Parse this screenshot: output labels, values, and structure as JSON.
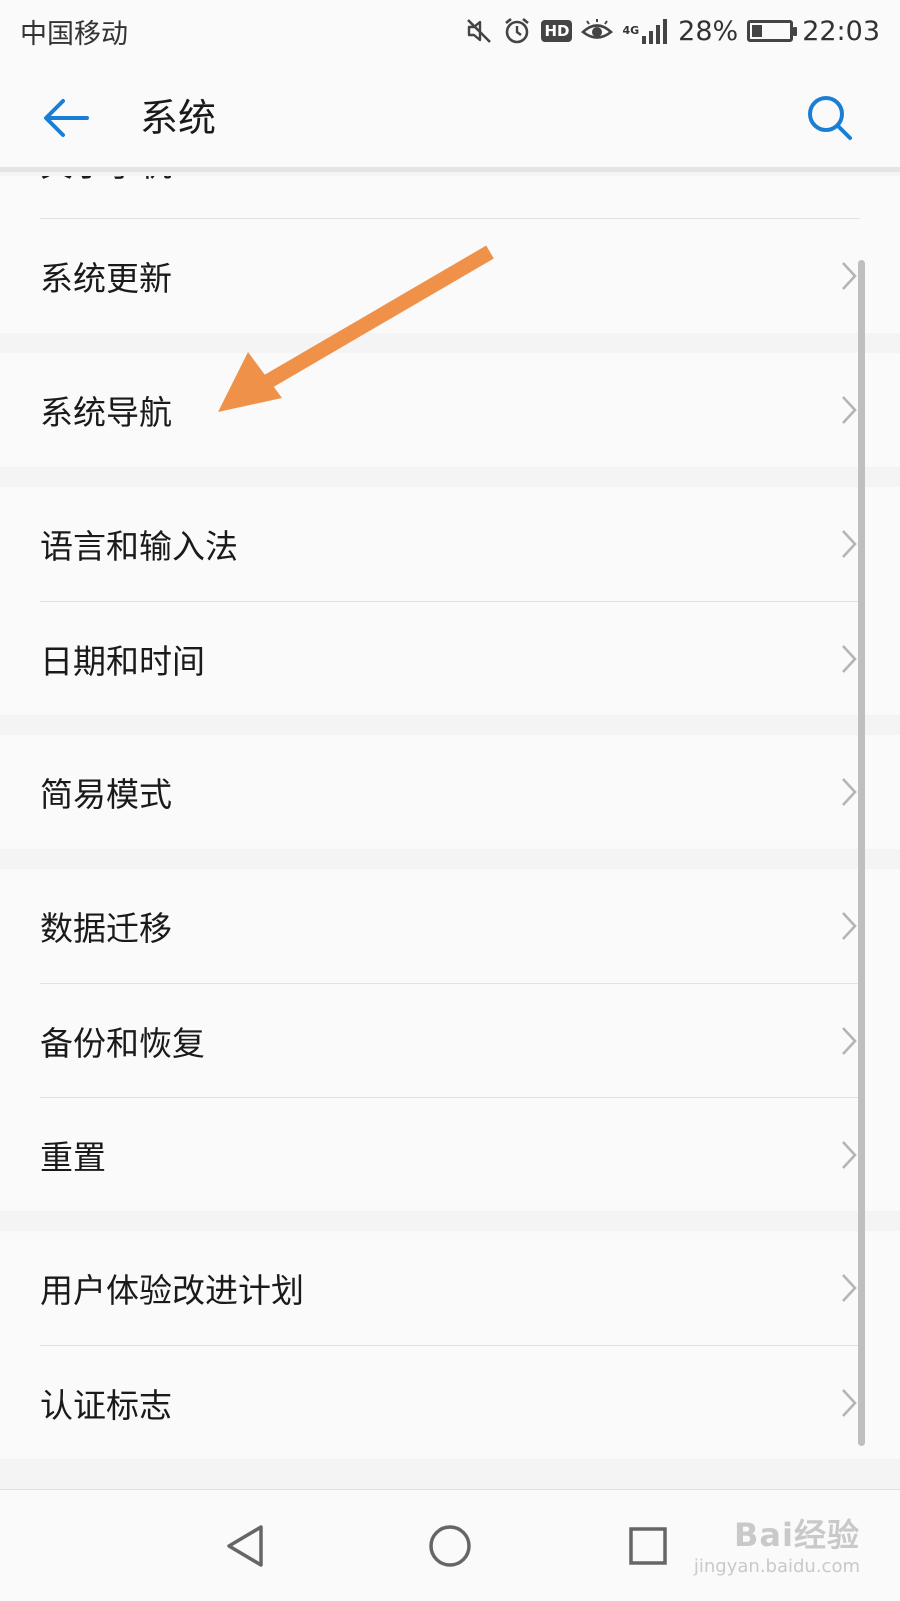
{
  "status_bar": {
    "carrier": "中国移动",
    "network_label": "4G",
    "battery_percent": "28%",
    "battery_level": 0.28,
    "time": "22:03",
    "hd_badge": "HD",
    "icons": [
      "mute-icon",
      "alarm-icon",
      "hd-icon",
      "eye-comfort-icon",
      "signal-icon",
      "battery-charging-icon"
    ]
  },
  "header": {
    "title": "系统",
    "back_icon": "back-arrow-icon",
    "search_icon": "search-icon",
    "accent_color": "#1a7fd4"
  },
  "partial_item": "关于手机",
  "groups": [
    {
      "items": [
        {
          "label": "系统更新"
        }
      ]
    },
    {
      "items": [
        {
          "label": "系统导航"
        }
      ]
    },
    {
      "items": [
        {
          "label": "语言和输入法"
        },
        {
          "label": "日期和时间"
        }
      ]
    },
    {
      "items": [
        {
          "label": "简易模式"
        }
      ]
    },
    {
      "items": [
        {
          "label": "数据迁移"
        },
        {
          "label": "备份和恢复"
        },
        {
          "label": "重置"
        }
      ]
    },
    {
      "items": [
        {
          "label": "用户体验改进计划"
        },
        {
          "label": "认证标志"
        }
      ]
    }
  ],
  "annotation": {
    "color": "#f0914a",
    "points_to": "系统导航"
  },
  "nav_bar": {
    "icons": [
      "back-triangle-icon",
      "home-circle-icon",
      "recents-square-icon"
    ]
  },
  "watermark": {
    "main": "Bai经验",
    "sub": "jingyan.baidu.com"
  }
}
